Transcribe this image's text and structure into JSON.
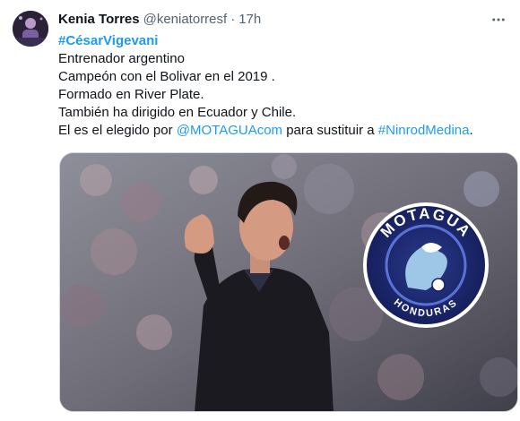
{
  "author": {
    "display_name": "Kenia Torres",
    "handle": "@keniatorresf",
    "separator": "·",
    "time": "17h"
  },
  "tweet": {
    "hashtag_main": "#CésarVigevani",
    "line1": "Entrenador argentino",
    "line2": "Campeón con el Bolivar en el 2019 .",
    "line3": "Formado en River Plate.",
    "line4": "También ha dirigido en Ecuador y Chile.",
    "line5_prefix": "El es el elegido por ",
    "mention": "@MOTAGUAcom",
    "line5_middle": " para sustituir a ",
    "hashtag2": "#NinrodMedina",
    "line5_suffix": "."
  },
  "media": {
    "logo_text_top": "MOTAGUA",
    "logo_text_bottom": "HONDURAS"
  },
  "icons": {
    "more": "more-horizontal-icon",
    "avatar": "avatar"
  },
  "colors": {
    "link": "#1d9bf0",
    "secondary_text": "#536471",
    "primary_text": "#0f1419",
    "logo_navy": "#1b2a78",
    "logo_blue": "#3f5bd0"
  }
}
